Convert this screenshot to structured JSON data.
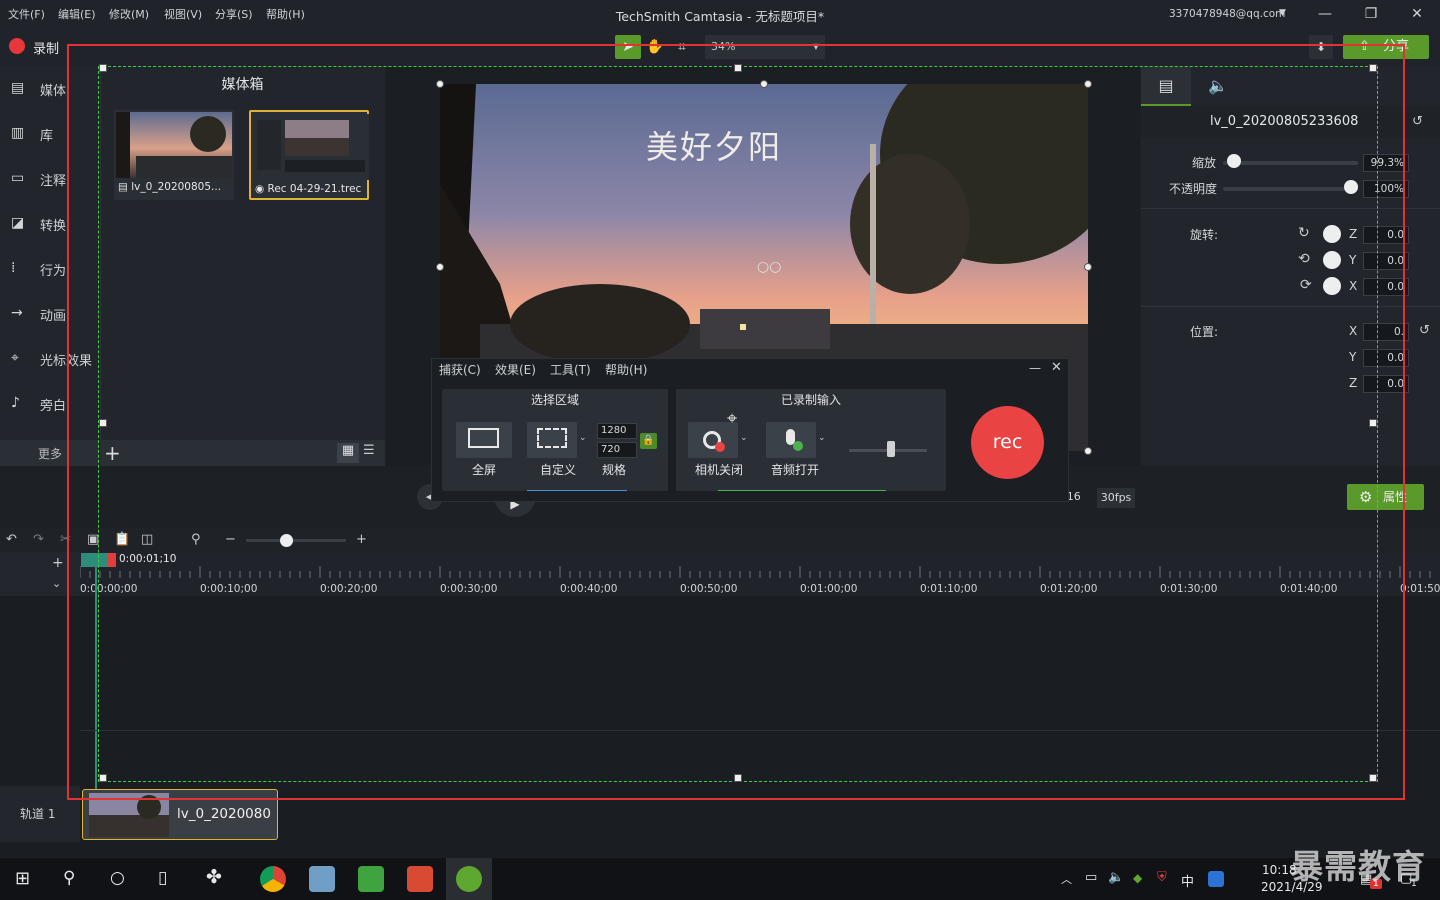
{
  "menu": [
    "文件(F)",
    "编辑(E)",
    "修改(M)",
    "视图(V)",
    "分享(S)",
    "帮助(H)"
  ],
  "app_title": "TechSmith Camtasia - 无标题项目*",
  "account": "3370478948@qq.com",
  "toolbar": {
    "record_label": "录制",
    "zoom_value": "34%",
    "share_label": "分享"
  },
  "sidebar": {
    "items": [
      {
        "label": "媒体",
        "icon": "film-strip-icon"
      },
      {
        "label": "库",
        "icon": "library-icon"
      },
      {
        "label": "注释",
        "icon": "annotation-icon"
      },
      {
        "label": "转换",
        "icon": "transition-icon"
      },
      {
        "label": "行为",
        "icon": "behavior-icon"
      },
      {
        "label": "动画",
        "icon": "animation-icon"
      },
      {
        "label": "光标效果",
        "icon": "cursor-icon"
      },
      {
        "label": "旁白",
        "icon": "microphone-icon"
      }
    ],
    "more_label": "更多"
  },
  "mediabin": {
    "title": "媒体箱",
    "items": [
      {
        "name": "lv_0_20200805..."
      },
      {
        "name": "Rec 04-29-21.trec"
      }
    ]
  },
  "canvas": {
    "overlay_text": "美好夕阳"
  },
  "properties": {
    "clip_name": "lv_0_20200805233608",
    "scale_label": "缩放",
    "scale_value": "99.3%",
    "scale_level": 0.08,
    "opacity_label": "不透明度",
    "opacity_value": "100%",
    "opacity_level": 1.0,
    "rotation_label": "旋转:",
    "rotation": [
      {
        "axis": "Z",
        "value": "0.0"
      },
      {
        "axis": "Y",
        "value": "0.0"
      },
      {
        "axis": "X",
        "value": "0.0"
      }
    ],
    "position_label": "位置:",
    "position": [
      {
        "axis": "X",
        "value": "0."
      },
      {
        "axis": "Y",
        "value": "0.0"
      },
      {
        "axis": "Z",
        "value": "0.0"
      }
    ],
    "attr_button": "属性"
  },
  "playback": {
    "ratio_fragment": ":16",
    "fps": "30fps"
  },
  "timeline": {
    "playhead_time": "0:00:01;10",
    "ticks": [
      "0:00:00;00",
      "0:00:10;00",
      "0:00:20;00",
      "0:00:30;00",
      "0:00:40;00",
      "0:00:50;00",
      "0:01:00;00",
      "0:01:10;00",
      "0:01:20;00",
      "0:01:30;00",
      "0:01:40;00",
      "0:01:50;"
    ],
    "zoom_level": 0.4,
    "track_label": "轨道 1",
    "clip_label": "lv_0_2020080"
  },
  "recorder": {
    "menu": [
      "捕获(C)",
      "效果(E)",
      "工具(T)",
      "帮助(H)"
    ],
    "select_area_title": "选择区域",
    "fullscreen_label": "全屏",
    "custom_label": "自定义",
    "spec_label": "规格",
    "width": "1280",
    "height": "720",
    "inputs_title": "已录制输入",
    "camera_label": "相机关闭",
    "audio_label": "音频打开",
    "rec_label": "rec"
  },
  "taskbar": {
    "time": "10:18",
    "date": "2021/4/29",
    "ime": "中",
    "badge": "1"
  },
  "watermark": "暴需教育",
  "colors": {
    "accent_green": "#5a9a2a",
    "record_red": "#e94343",
    "selection_yellow": "#e0b335",
    "guide_green": "#3fcc3f",
    "annotation_red": "#e23333"
  }
}
